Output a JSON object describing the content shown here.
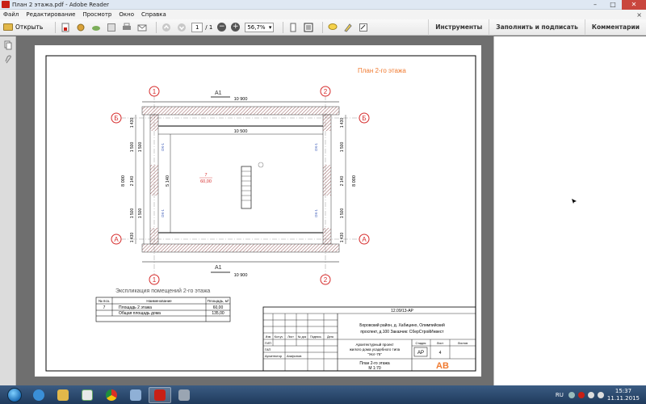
{
  "window": {
    "title": "План 2 этажа.pdf - Adobe Reader",
    "minimize": "–",
    "maximize": "□",
    "close": "✕"
  },
  "menu": {
    "items": [
      "Файл",
      "Редактирование",
      "Просмотр",
      "Окно",
      "Справка"
    ],
    "close": "×"
  },
  "toolbar": {
    "open_label": "Открыть",
    "page_current": "1",
    "page_total": "/ 1",
    "zoom_value": "56,7%",
    "zoom_out": "−",
    "zoom_in": "+",
    "tools_label": "Инструменты",
    "fill_sign_label": "Заполнить и подписать",
    "comments_label": "Комментарии"
  },
  "drawing": {
    "title": "План 2-го этажа",
    "axes": {
      "grid_1": "1",
      "grid_2": "2",
      "grid_b": "Б",
      "grid_a": "А",
      "section_top": "A1",
      "section_bottom": "A1"
    },
    "dims": {
      "top_overall": "10 900",
      "inner_width": "10 500",
      "bottom_overall": "10 900",
      "left_overall": "8 000",
      "right_overall": "8 000",
      "left_1430_top": "1 430",
      "left_1500a": "1 500",
      "left_1500b": "1 500",
      "left_2140": "2 140",
      "left_1500c": "1 500",
      "left_1500d": "1 500",
      "left_1430_bot": "1 430",
      "inner_height": "5 140",
      "right_1430_top": "1 430",
      "right_1500a": "1 500",
      "right_2140": "2 140",
      "right_1500b": "1 500",
      "right_1430_bot": "1 430"
    },
    "room": {
      "number": "7",
      "area": "60,00"
    },
    "window_tags": {
      "ok_left_top": "ОК-1",
      "ok_left_bot": "ОК-1",
      "ok_right_top": "ОК-1",
      "ok_right_bot": "ОК-1"
    },
    "explication": {
      "heading": "Экспликация помещений 2-го этажа",
      "headers": [
        "№ поз.",
        "Наименование",
        "Площадь, м²"
      ],
      "rows": [
        [
          "7",
          "Площадь 2 этажа",
          "60,00"
        ],
        [
          "",
          "Общая площадь дома",
          "135,00"
        ]
      ]
    },
    "stamp": {
      "code": "12.09/13-АР",
      "address": "Боровский район, д. Хабицино, Олимпийский",
      "address2": "проспект, д.100  Заказчик: СберСтройИнвест",
      "header_cells": [
        "Изм",
        "Кол.уч",
        "Лист",
        "№ док",
        "Подпись",
        "Дата"
      ],
      "role_gip": "ГИП",
      "role_gap": "ГАП",
      "role_architect": "Архитектор",
      "architect_name": "Агафонов",
      "project_line1": "Архитектурный проект",
      "project_line2": "жилого дома усадебного типа",
      "project_line3": "\"Уют-75\"",
      "stage_label": "Стадия",
      "sheet_label": "Лист",
      "sheets_label": "Листов",
      "stage": "АР",
      "sheet": "4",
      "sheet_title": "План 2-го этажа",
      "scale": "М 1:70",
      "logo": "АВ"
    }
  },
  "taskbar": {
    "lang": "RU",
    "time": "15:37",
    "date": "11.11.2015"
  },
  "colors": {
    "axis_red": "#d62b2b",
    "title_orange": "#f07a30",
    "window_blue": "#3b5ab8",
    "wall_hatch": "#7a3030"
  }
}
